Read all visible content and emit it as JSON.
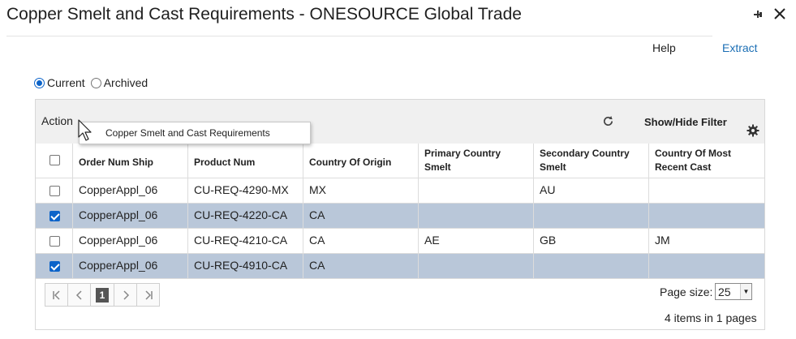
{
  "window": {
    "title": "Copper Smelt and Cast Requirements - ONESOURCE Global Trade",
    "icons": {
      "pin": "pin-icon",
      "close": "close-icon"
    }
  },
  "links": {
    "help": "Help",
    "extract": "Extract"
  },
  "filter": {
    "options": [
      {
        "label": "Current",
        "selected": true
      },
      {
        "label": "Archived",
        "selected": false
      }
    ]
  },
  "toolbar": {
    "action_label": "Action",
    "action_menu_item": "Copper Smelt and Cast Requirements",
    "show_hide_filter": "Show/Hide Filter",
    "icons": {
      "refresh": "refresh-icon",
      "settings": "gear-icon"
    }
  },
  "table": {
    "columns": [
      "Order Num Ship",
      "Product Num",
      "Country Of Origin",
      "Primary Country Smelt",
      "Secondary Country Smelt",
      "Country Of Most Recent Cast"
    ],
    "rows": [
      {
        "selected": false,
        "cells": [
          "CopperAppl_06",
          "CU-REQ-4290-MX",
          "MX",
          "",
          "AU",
          ""
        ]
      },
      {
        "selected": true,
        "cells": [
          "CopperAppl_06",
          "CU-REQ-4220-CA",
          "CA",
          "",
          "",
          ""
        ]
      },
      {
        "selected": false,
        "cells": [
          "CopperAppl_06",
          "CU-REQ-4210-CA",
          "CA",
          "AE",
          "GB",
          "JM"
        ]
      },
      {
        "selected": true,
        "cells": [
          "CopperAppl_06",
          "CU-REQ-4910-CA",
          "CA",
          "",
          "",
          ""
        ]
      }
    ]
  },
  "pager": {
    "current_page": "1",
    "page_size_label": "Page size:",
    "page_size": "25",
    "items_info": "4 items in 1 pages"
  },
  "colors": {
    "accent": "#0b63c9",
    "link": "#1c6fb5",
    "selected_row": "#b9c7d9",
    "toolbar_bg": "#f0f0f0"
  }
}
